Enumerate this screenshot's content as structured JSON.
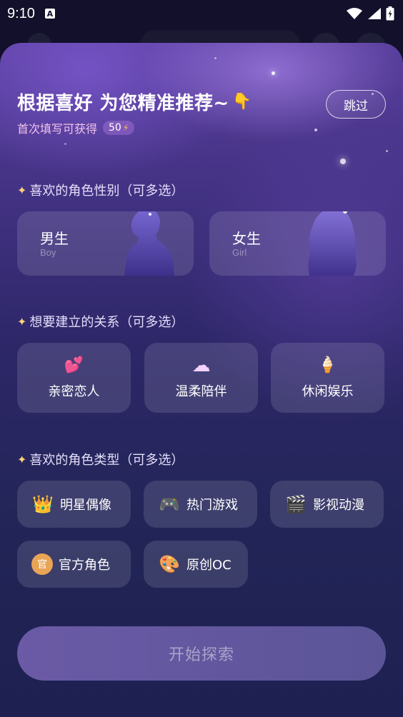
{
  "status_bar": {
    "time": "9:10",
    "app_badge": "A"
  },
  "header": {
    "title": "根据喜好 为您精准推荐~",
    "title_icon": "pointing-down-hand-icon",
    "subtitle": "首次填写可获得",
    "bonus_value": "50",
    "bonus_icon": "lightning-icon",
    "skip_label": "跳过"
  },
  "sections": {
    "gender": {
      "title": "喜欢的角色性别（可多选）",
      "options": [
        {
          "cn": "男生",
          "en": "Boy"
        },
        {
          "cn": "女生",
          "en": "Girl"
        }
      ]
    },
    "relationship": {
      "title": "想要建立的关系（可多选）",
      "options": [
        {
          "label": "亲密恋人",
          "icon": "hearts-icon",
          "glyph": "💕"
        },
        {
          "label": "温柔陪伴",
          "icon": "cloud-icon",
          "glyph": "☁"
        },
        {
          "label": "休闲娱乐",
          "icon": "ice-cream-icon",
          "glyph": "🍦"
        }
      ]
    },
    "role_type": {
      "title": "喜欢的角色类型（可多选）",
      "options": [
        {
          "label": "明星偶像",
          "icon": "crown-icon",
          "glyph": "👑"
        },
        {
          "label": "热门游戏",
          "icon": "gamepad-icon",
          "glyph": "🎮"
        },
        {
          "label": "影视动漫",
          "icon": "clapperboard-icon",
          "glyph": "🎬"
        },
        {
          "label": "官方角色",
          "icon": "official-badge-icon",
          "glyph": "官"
        },
        {
          "label": "原创OC",
          "icon": "palette-icon",
          "glyph": "🎨"
        }
      ]
    }
  },
  "start_button": {
    "label": "开始探索"
  },
  "colors": {
    "accent_pink": "#f0c2ea",
    "lightning": "#ffc94a",
    "sparkle": "#ffd07a",
    "start_button": "#6b5aa6"
  }
}
